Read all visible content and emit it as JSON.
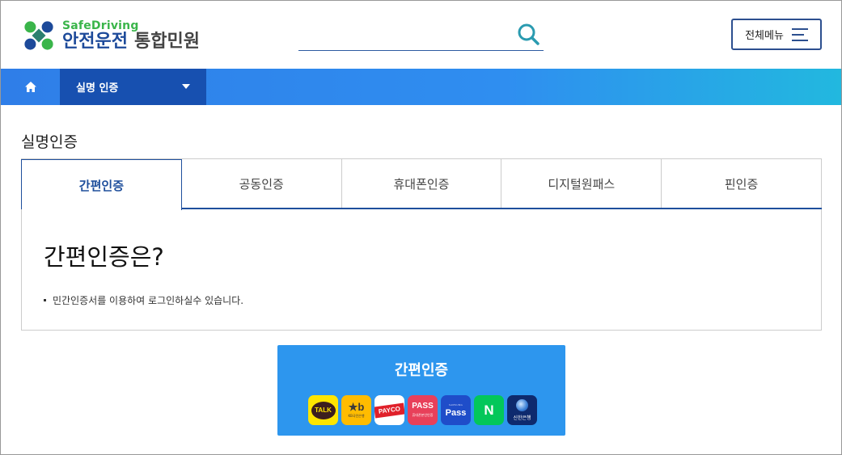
{
  "header": {
    "logo_sub": "SafeDriving",
    "logo_main": "안전운전",
    "logo_suffix": "통합민원",
    "search_placeholder": "",
    "menu_label": "전체메뉴"
  },
  "nav": {
    "current": "실명 인증"
  },
  "page": {
    "title": "실명인증",
    "tabs": [
      {
        "label": "간편인증",
        "active": true
      },
      {
        "label": "공동인증",
        "active": false
      },
      {
        "label": "휴대폰인증",
        "active": false
      },
      {
        "label": "디지털원패스",
        "active": false
      },
      {
        "label": "핀인증",
        "active": false
      }
    ],
    "panel_heading": "간편인증은?",
    "panel_bullet": "민간인증서를 이용하여 로그인하실수 있습니다."
  },
  "auth": {
    "label": "간편인증",
    "providers": [
      {
        "name": "kakao",
        "text": "TALK"
      },
      {
        "name": "kb",
        "text": "★b",
        "sub": "KB국민은행"
      },
      {
        "name": "payco",
        "text": "PAYCO"
      },
      {
        "name": "pass",
        "text": "PASS",
        "sub": "휴대폰본인인증"
      },
      {
        "name": "samsung-pass",
        "text": "Pass",
        "sub": "SAMSUNG"
      },
      {
        "name": "naver",
        "text": "N"
      },
      {
        "name": "shinhan",
        "sub": "신한은행"
      }
    ]
  },
  "colors": {
    "brand_blue": "#1d4a9a",
    "brand_green": "#3ab54a",
    "nav_dark": "#1750b0",
    "auth_button": "#2d96ee"
  }
}
